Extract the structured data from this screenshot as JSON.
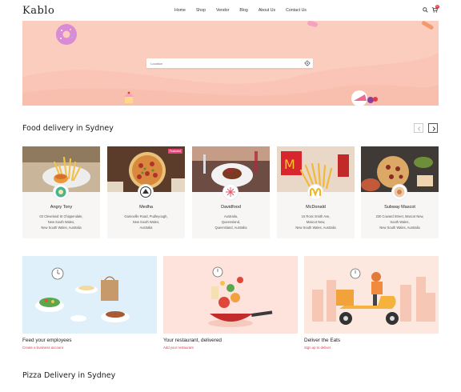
{
  "header": {
    "logo": "Kablo",
    "nav": [
      "Home",
      "Shop",
      "Vendor",
      "Blog",
      "About Us",
      "Contact Us"
    ],
    "cart_count": "0"
  },
  "hero": {
    "search_placeholder": "Location"
  },
  "sections": {
    "food_delivery_title": "Food delivery in Sydney",
    "pizza_delivery_title": "Pizza Delivery in Sydney"
  },
  "restaurants": [
    {
      "name": "Angry Tony",
      "address": [
        "03 Cleveland St Chippendale,",
        "New South Wales,",
        "New South Wales, Australia"
      ],
      "featured": ""
    },
    {
      "name": "Medha",
      "address": [
        "Gamoville Road, Pudleyough,",
        "New South Wales,",
        "Australia"
      ],
      "featured": "Featured"
    },
    {
      "name": "Davidfood",
      "address": [
        "Australia,",
        "Queensland,",
        "Queensland, Australia"
      ],
      "featured": ""
    },
    {
      "name": "McDonald",
      "address": [
        "15 Ross Smith Ave,",
        "Mascot New,",
        "New South Wales, Australia"
      ],
      "featured": ""
    },
    {
      "name": "Subway Mascot",
      "address": [
        "230 Coward Street, Mascot New,",
        "South Wales,",
        "New South Wales, Australia"
      ],
      "featured": ""
    }
  ],
  "promos": [
    {
      "title": "Feed your employees",
      "link": "Create a business account"
    },
    {
      "title": "Your restaurant, delivered",
      "link": "Add your restaurant"
    },
    {
      "title": "Deliver the Eats",
      "link": "Sign up to deliver"
    }
  ],
  "colors": {
    "hero_bg": "#fbcdbe",
    "accent_red": "#e53946",
    "featured_pink": "#e5457a",
    "promo1_bg": "#dff0fa",
    "promo2_bg": "#fde3dc",
    "promo3_bg": "#fde8e0"
  },
  "icons": {
    "search": "search-icon",
    "cart": "cart-icon",
    "locate": "crosshair-icon",
    "prev": "chevron-left-icon",
    "next": "chevron-right-icon"
  }
}
